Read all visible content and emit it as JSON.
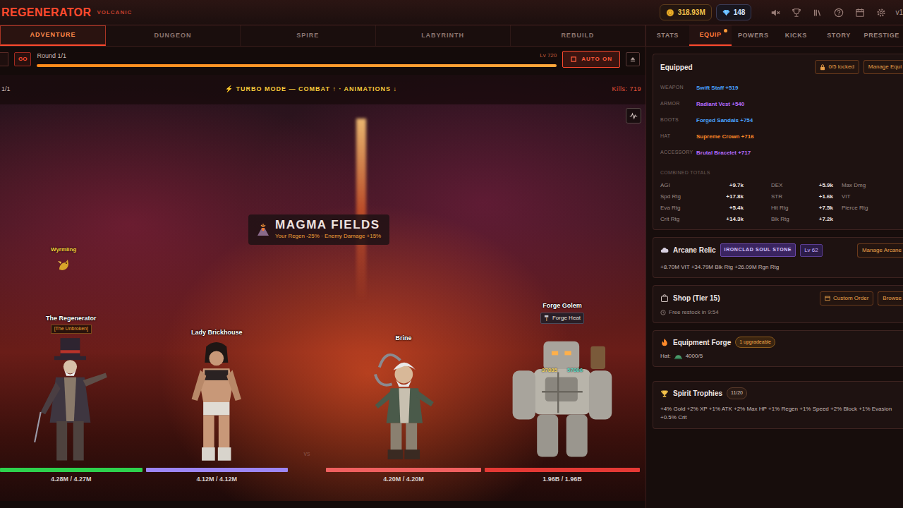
{
  "header": {
    "title": "REGENERATOR",
    "subtitle": "VOLCANIC",
    "gold": "318.93M",
    "gems": "148",
    "version": "v1"
  },
  "main_tabs": [
    {
      "label": "ADVENTURE",
      "selected": true
    },
    {
      "label": "DUNGEON",
      "selected": false
    },
    {
      "label": "SPIRE",
      "selected": false
    },
    {
      "label": "LABYRINTH",
      "selected": false
    },
    {
      "label": "REBUILD",
      "selected": false
    }
  ],
  "panel_tabs": [
    {
      "label": "STATS",
      "selected": false,
      "dot": false
    },
    {
      "label": "EQUIP",
      "selected": true,
      "dot": true
    },
    {
      "label": "POWERS",
      "selected": false,
      "dot": false
    },
    {
      "label": "KICKS",
      "selected": false,
      "dot": false
    },
    {
      "label": "STORY",
      "selected": false,
      "dot": false
    },
    {
      "label": "PRESTIGE",
      "selected": false,
      "dot": false
    }
  ],
  "battle_bar": {
    "go": "GO",
    "round": "Round 1/1",
    "progress": 1,
    "level_text": "Lv 720",
    "auto": "AUTO ON",
    "auto_on": true
  },
  "arena": {
    "wave": "1/1",
    "turbo": "⚡ TURBO MODE — COMBAT ↑ · ANIMATIONS ↓",
    "kills": "Kills: 719",
    "zone": {
      "name": "MAGMA FIELDS",
      "effect": "Your Regen -25% · Enemy Damage +15%"
    },
    "pet": "Wyrmling",
    "versus": "vs",
    "fighters": [
      {
        "name": "The Regenerator",
        "title": "[The Unbroken]",
        "kind": "hatted",
        "side": "ally",
        "hp": "4.28M / 4.27M",
        "hp_level": 1,
        "color": "#2ed14d"
      },
      {
        "name": "Lady Brickhouse",
        "kind": "brawler",
        "side": "ally",
        "hp": "4.12M / 4.12M",
        "hp_level": 1,
        "color": "#9d86f5"
      },
      {
        "name": "Brine",
        "kind": "sailor",
        "side": "enemy",
        "hp": "4.20M / 4.20M",
        "hp_level": 1,
        "color": "#f06060"
      },
      {
        "name": "Forge Golem",
        "badge": "Forge Heat",
        "kind": "golem",
        "side": "enemy",
        "hp": "1.96B / 1.96B",
        "hp_level": 1,
        "color": "#e53935",
        "floaters": [
          {
            "text": "37885",
            "color": "#f0d060"
          },
          {
            "text": "57866",
            "color": "#5fd6c0"
          }
        ]
      }
    ]
  },
  "equipped": {
    "title": "Equipped",
    "locked": "0/5 locked",
    "manage": "Manage Equi",
    "slots": [
      {
        "slot": "WEAPON",
        "item": "Swift Staff +519",
        "color": "#4aa3ff"
      },
      {
        "slot": "ARMOR",
        "item": "Radiant Vest +540",
        "color": "#b46cff"
      },
      {
        "slot": "BOOTS",
        "item": "Forged Sandals +754",
        "color": "#4aa3ff"
      },
      {
        "slot": "HAT",
        "item": "Supreme Crown +716",
        "color": "#ff8a2a"
      },
      {
        "slot": "ACCESSORY",
        "item": "Brutal Bracelet +717",
        "color": "#b46cff"
      }
    ],
    "totals_title": "COMBINED TOTALS",
    "totals": [
      {
        "label": "AGI",
        "value": "+9.7k"
      },
      {
        "label": "DEX",
        "value": "+5.9k"
      },
      {
        "label": "Max Dmg"
      },
      {
        "label": "Spd Rtg",
        "value": "+17.8k"
      },
      {
        "label": "STR",
        "value": "+1.6k"
      },
      {
        "label": "VIT"
      },
      {
        "label": "Eva Rtg",
        "value": "+5.4k"
      },
      {
        "label": "Hit Rtg",
        "value": "+7.5k"
      },
      {
        "label": "Pierce Rtg"
      },
      {
        "label": "Crit Rtg",
        "value": "+14.3k"
      },
      {
        "label": "Blk Rtg",
        "value": "+7.2k"
      }
    ]
  },
  "arcane": {
    "title": "Arcane Relic",
    "relic": "IRONCLAD SOUL STONE",
    "level": "Lv 62",
    "manage": "Manage Arcane",
    "bonus": "+8.70M VIT +34.79M Blk Rtg +26.09M Rgn Rtg"
  },
  "shop": {
    "title": "Shop (Tier 15)",
    "restock": "Free restock in 9:54",
    "custom": "Custom Order",
    "browse": "Browse"
  },
  "forge": {
    "title": "Equipment Forge",
    "badge": "1 upgradeable",
    "label": "Hat:",
    "value": "4000/5"
  },
  "trophies": {
    "title": "Spirit Trophies",
    "count": "11/20",
    "bonus": "+4% Gold +2% XP +1% ATK +2% Max HP +1% Regen +1% Speed +2% Block +1% Evasion +0.5% Crit"
  }
}
